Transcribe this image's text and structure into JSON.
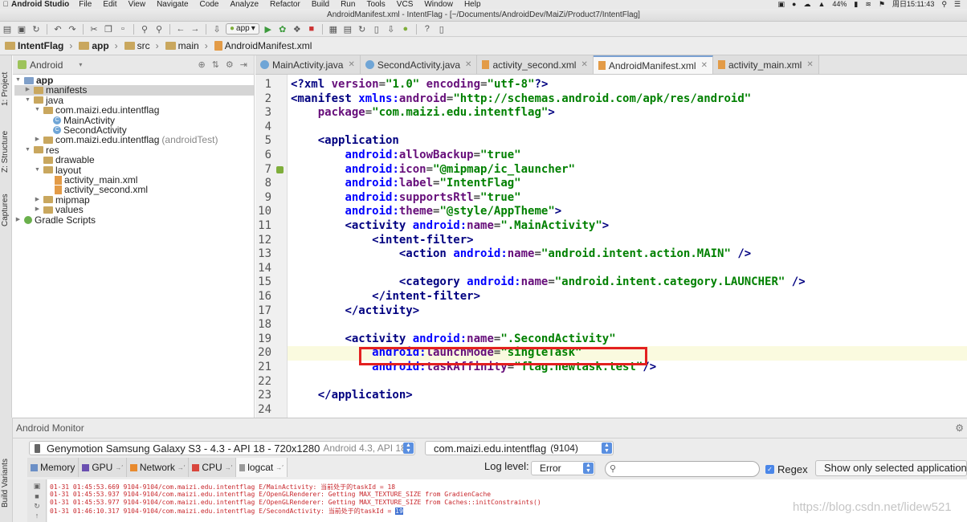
{
  "menubar": {
    "app_name": "Android Studio",
    "items": [
      "File",
      "Edit",
      "View",
      "Navigate",
      "Code",
      "Analyze",
      "Refactor",
      "Build",
      "Run",
      "Tools",
      "VCS",
      "Window",
      "Help"
    ],
    "battery": "44%",
    "clock": "周日15:11:43"
  },
  "window": {
    "title": "AndroidManifest.xml - IntentFlag - [~/Documents/AndroidDev/MaiZi/Product7/IntentFlag]"
  },
  "toolbar": {
    "run_config": "app"
  },
  "breadcrumb": [
    "IntentFlag",
    "app",
    "src",
    "main",
    "AndroidManifest.xml"
  ],
  "sidebar_left": {
    "project_tab": "1: Project",
    "structure_tab": "Z: Structure",
    "captures_tab": "Captures",
    "build_variants_tab": "Build Variants"
  },
  "project_panel": {
    "view_mode": "Android",
    "tree": [
      {
        "label": "app",
        "icon": "module-folder",
        "expanded": true
      },
      {
        "label": "manifests",
        "icon": "folder",
        "selected": true
      },
      {
        "label": "java",
        "icon": "folder",
        "expanded": true
      },
      {
        "label": "com.maizi.edu.intentflag",
        "icon": "package",
        "expanded": true
      },
      {
        "label": "MainActivity",
        "icon": "class"
      },
      {
        "label": "SecondActivity",
        "icon": "class"
      },
      {
        "label": "com.maizi.edu.intentflag",
        "suffix": "(androidTest)",
        "icon": "package"
      },
      {
        "label": "res",
        "icon": "folder",
        "expanded": true
      },
      {
        "label": "drawable",
        "icon": "folder"
      },
      {
        "label": "layout",
        "icon": "folder",
        "expanded": true
      },
      {
        "label": "activity_main.xml",
        "icon": "xml"
      },
      {
        "label": "activity_second.xml",
        "icon": "xml"
      },
      {
        "label": "mipmap",
        "icon": "folder"
      },
      {
        "label": "values",
        "icon": "folder"
      },
      {
        "label": "Gradle Scripts",
        "icon": "gradle"
      }
    ]
  },
  "editor_tabs": [
    {
      "label": "MainActivity.java",
      "icon": "class"
    },
    {
      "label": "SecondActivity.java",
      "icon": "class"
    },
    {
      "label": "activity_second.xml",
      "icon": "xml"
    },
    {
      "label": "AndroidManifest.xml",
      "icon": "xml",
      "active": true
    },
    {
      "label": "activity_main.xml",
      "icon": "xml"
    }
  ],
  "code_lines": [
    "<?xml version=\"1.0\" encoding=\"utf-8\"?>",
    "<manifest xmlns:android=\"http://schemas.android.com/apk/res/android\"",
    "    package=\"com.maizi.edu.intentflag\">",
    "",
    "    <application",
    "        android:allowBackup=\"true\"",
    "        android:icon=\"@mipmap/ic_launcher\"",
    "        android:label=\"IntentFlag\"",
    "        android:supportsRtl=\"true\"",
    "        android:theme=\"@style/AppTheme\">",
    "        <activity android:name=\".MainActivity\">",
    "            <intent-filter>",
    "                <action android:name=\"android.intent.action.MAIN\" />",
    "",
    "                <category android:name=\"android.intent.category.LAUNCHER\" />",
    "            </intent-filter>",
    "        </activity>",
    "",
    "        <activity android:name=\".SecondActivity\"",
    "            android:launchMode=\"singleTask\"",
    "            android:taskAffinity=\"flag.newtask.test\"/>",
    "",
    "    </application>",
    ""
  ],
  "monitor": {
    "title": "Android Monitor",
    "device": "Genymotion Samsung Galaxy S3 - 4.3 - API 18 - 720x1280",
    "device_suffix": "Android 4.3, API 18",
    "process": "com.maizi.edu.intentflag",
    "process_pid": "(9104)",
    "tabs": [
      "Memory",
      "GPU",
      "Network",
      "CPU",
      "logcat"
    ],
    "log_level_label": "Log level:",
    "log_level": "Error",
    "search_placeholder": "",
    "regex_label": "Regex",
    "regex_checked": true,
    "filter": "Show only selected application",
    "log_lines": [
      "01-31 01:45:53.669 9104-9104/com.maizi.edu.intentflag E/MainActivity: 当前处于的taskId = 18",
      "01-31 01:45:53.937 9104-9104/com.maizi.edu.intentflag E/OpenGLRenderer: Getting MAX_TEXTURE_SIZE from GradienCache",
      "01-31 01:45:53.977 9104-9104/com.maizi.edu.intentflag E/OpenGLRenderer: Getting MAX_TEXTURE_SIZE from Caches::initConstraints()",
      "01-31 01:46:10.317 9104-9104/com.maizi.edu.intentflag E/SecondActivity: 当前处于的taskId = "
    ],
    "last_task_id": "19"
  },
  "watermark": "https://blog.csdn.net/lidew521",
  "colors": {
    "highlight_box": "#e32020",
    "xml_tag": "#000080",
    "xml_attr": "#660e7a",
    "xml_value": "#008000",
    "log_error": "#c8272c"
  }
}
